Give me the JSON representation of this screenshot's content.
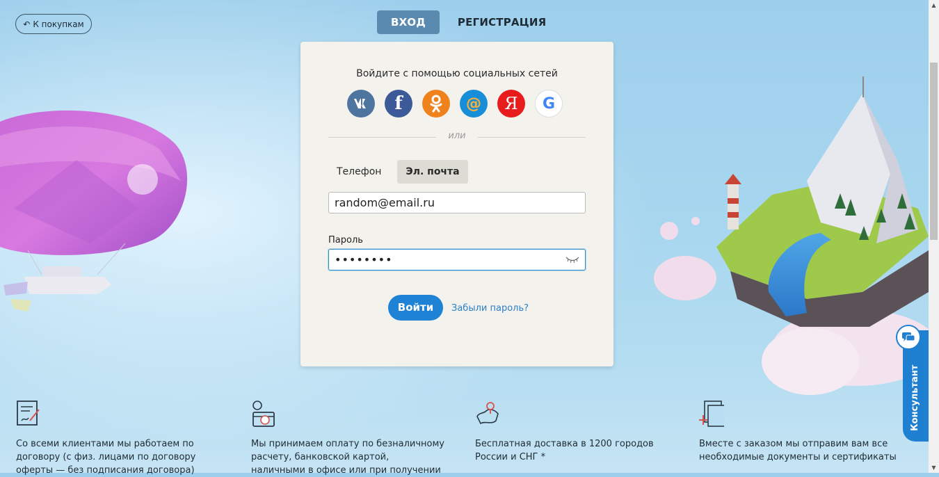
{
  "nav": {
    "back_label": "К покупкам"
  },
  "auth_tabs": {
    "login": "ВХОД",
    "register": "РЕГИСТРАЦИЯ"
  },
  "social": {
    "title": "Войдите с помощью социальных сетей",
    "providers": [
      "vk-icon",
      "facebook-icon",
      "odnoklassniki-icon",
      "mail-ru-icon",
      "yandex-icon",
      "google-icon"
    ],
    "fb_glyph": "f",
    "ya_glyph": "Я",
    "g_glyph": "G"
  },
  "divider_text": "или",
  "mode_tabs": {
    "phone": "Телефон",
    "email": "Эл. почта"
  },
  "form": {
    "email_value": "random@email.ru",
    "password_label": "Пароль",
    "password_value": "••••••••",
    "submit_label": "Войти",
    "forgot_label": "Забыли пароль?"
  },
  "features": [
    {
      "icon": "contract-icon",
      "text": "Со всеми клиентами мы работаем по договору (с физ. лицами по договору оферты — без подписания договора)"
    },
    {
      "icon": "payment-icon",
      "text": "Мы принимаем оплату по безналичному расчету, банковской картой, наличными в офисе или при получении"
    },
    {
      "icon": "map-delivery-icon",
      "text": "Бесплатная доставка в 1200 городов России и СНГ *"
    },
    {
      "icon": "documents-icon",
      "text": "Вместе с заказом мы отправим вам все необходимые документы и сертификаты"
    }
  ],
  "consultant_label": "Консультант",
  "colors": {
    "accent": "#1e83d5",
    "tab_active": "#5b8ab1",
    "card_bg": "#f3f2ed"
  }
}
